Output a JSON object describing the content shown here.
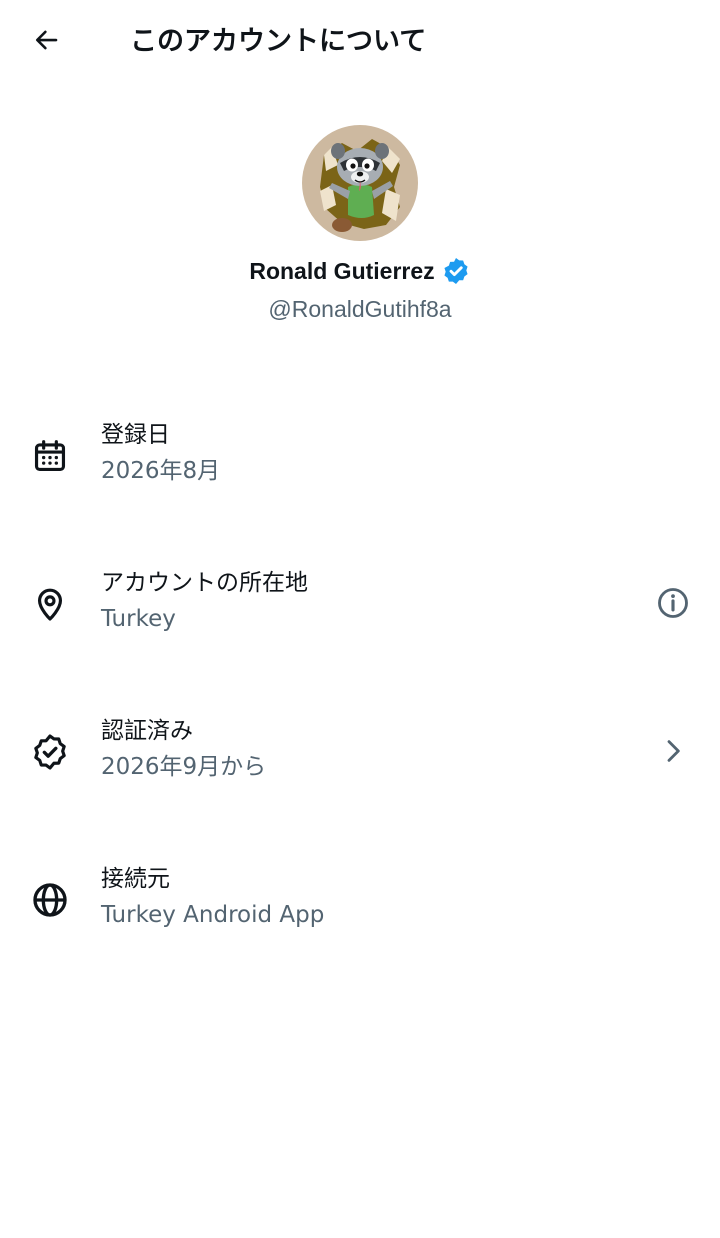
{
  "header": {
    "title": "このアカウントについて",
    "back_icon": "arrow-left-icon"
  },
  "profile": {
    "display_name": "Ronald Gutierrez",
    "handle": "@RonaldGutihf8a",
    "verified_icon": "verified-badge-icon",
    "verified_color": "#1d9bf0"
  },
  "details": {
    "joined": {
      "icon": "calendar-icon",
      "label": "登録日",
      "value": "2026年8月"
    },
    "location": {
      "icon": "location-pin-icon",
      "label": "アカウントの所在地",
      "value": "Turkey",
      "trailing_icon": "info-icon"
    },
    "verified": {
      "icon": "verified-check-icon",
      "label": "認証済み",
      "value": "2026年9月から",
      "trailing_icon": "chevron-right-icon"
    },
    "connected_via": {
      "icon": "globe-icon",
      "label": "接続元",
      "value": "Turkey Android App"
    }
  },
  "colors": {
    "primary_text": "#0f1419",
    "secondary_text": "#536471",
    "accent": "#1d9bf0"
  }
}
